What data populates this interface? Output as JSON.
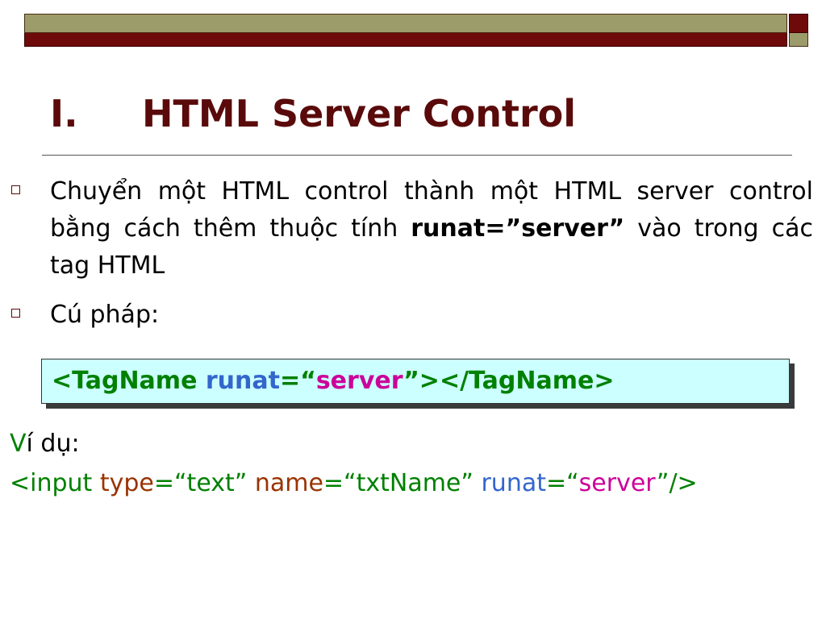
{
  "colors": {
    "title": "#5a0a0a",
    "olive_bar": "#9c9b6a",
    "maroon_bar": "#6e0a0a",
    "syntax_bg": "#ccffff",
    "green": "#008000",
    "blue": "#3366cc",
    "magenta": "#cc0099",
    "brown": "#993300"
  },
  "title": {
    "number": "I.",
    "text": "HTML Server Control"
  },
  "bullets": {
    "b1_pre": "Chuyển một HTML control thành một HTML server control bằng cách thêm thuộc tính ",
    "b1_bold": "runat=”server”",
    "b1_post": " vào trong các tag HTML",
    "b2": "Cú pháp:"
  },
  "syntax": {
    "open": "<TagName ",
    "attr": "runat",
    "eq_quote": "=“",
    "value": "server",
    "close": "”></TagName>"
  },
  "example": {
    "label_v": "V",
    "label_rest": "í dụ:",
    "c_open": "<input ",
    "c_type_attr": "type",
    "c_type_val": "=“text” ",
    "c_name_attr": "name",
    "c_name_val": "=“txtName” ",
    "c_runat_attr": "runat",
    "c_runat_eq": "=“",
    "c_runat_val": "server",
    "c_end": "”/>"
  }
}
